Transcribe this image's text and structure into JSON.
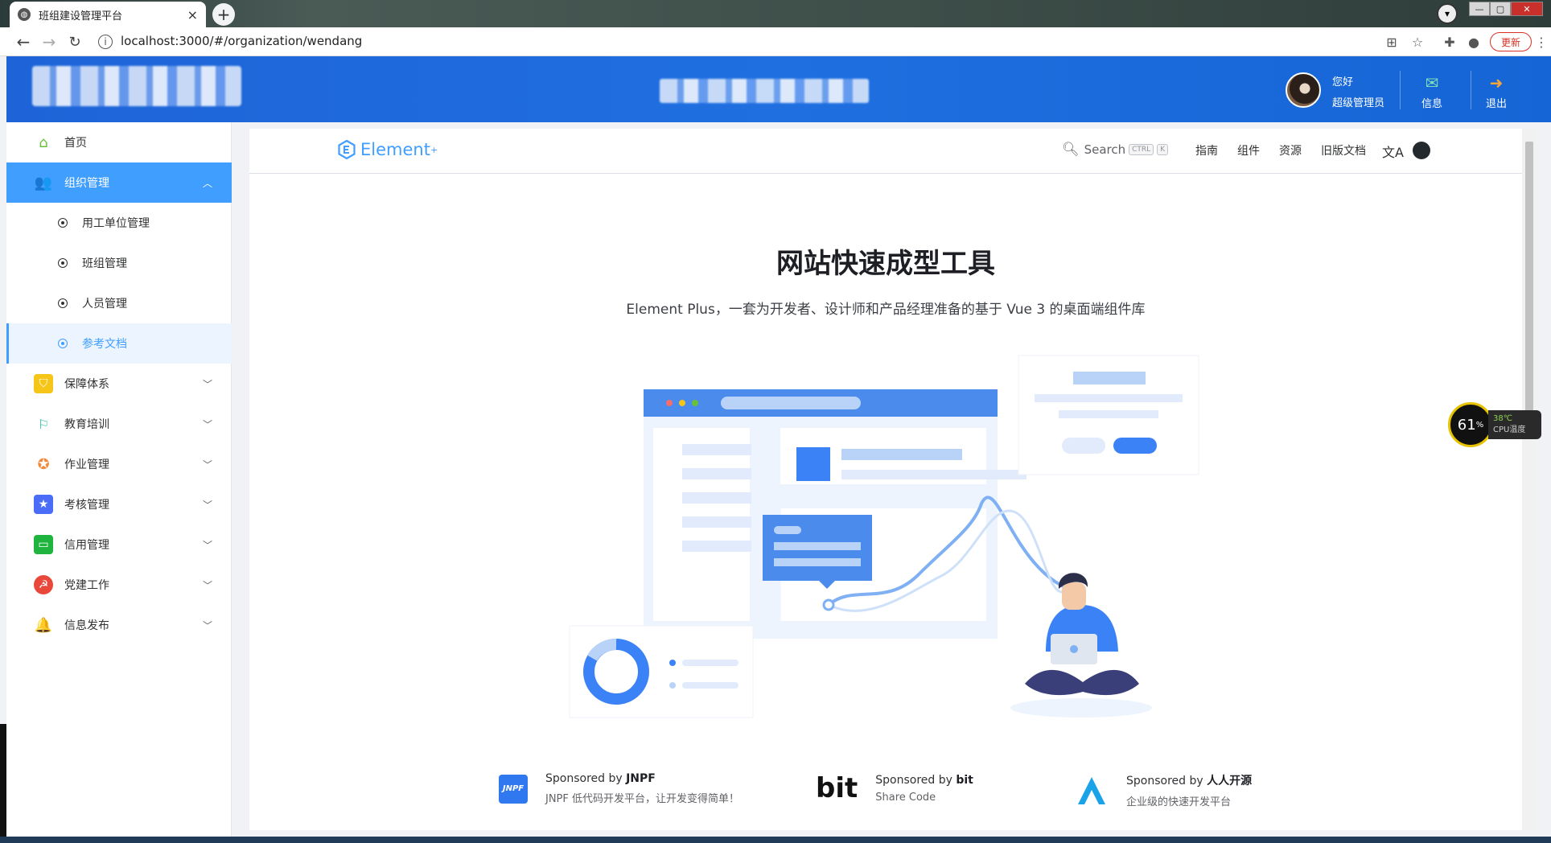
{
  "browser": {
    "tab_title": "班组建设管理平台",
    "tab_close": "×",
    "new_tab": "+",
    "url": "localhost:3000/#/organization/wendang",
    "update_label": "更新",
    "window_buttons": [
      "—",
      "▢",
      "✕"
    ]
  },
  "header": {
    "greeting": "您好",
    "role": "超级管理员",
    "message_label": "信息",
    "logout_label": "退出"
  },
  "sidebar": {
    "items": [
      {
        "label": "首页",
        "icon": "home-icon",
        "color": "#67c23a"
      },
      {
        "label": "组织管理",
        "icon": "users-icon",
        "color": "#409eff",
        "expanded": true
      },
      {
        "label": "保障体系",
        "icon": "shield-icon",
        "color": "#f5c518"
      },
      {
        "label": "教育培训",
        "icon": "training-icon",
        "color": "#1bbc9b"
      },
      {
        "label": "作业管理",
        "icon": "task-icon",
        "color": "#f08a3c"
      },
      {
        "label": "考核管理",
        "icon": "assessment-icon",
        "color": "#4a6cf7"
      },
      {
        "label": "信用管理",
        "icon": "credit-icon",
        "color": "#1fb43e"
      },
      {
        "label": "党建工作",
        "icon": "party-icon",
        "color": "#e8473a"
      },
      {
        "label": "信息发布",
        "icon": "bell-icon",
        "color": "#2aa4f4"
      }
    ],
    "sub_items": [
      {
        "label": "用工单位管理"
      },
      {
        "label": "班组管理"
      },
      {
        "label": "人员管理"
      },
      {
        "label": "参考文档",
        "active": true
      }
    ]
  },
  "docs": {
    "logo_text": "Element",
    "search_label": "Search",
    "search_keys": [
      "CTRL",
      "K"
    ],
    "nav": [
      "指南",
      "组件",
      "资源",
      "旧版文档"
    ],
    "hero_title": "网站快速成型工具",
    "hero_subtitle": "Element Plus，一套为开发者、设计师和产品经理准备的基于 Vue 3 的桌面端组件库",
    "sponsors": [
      {
        "prefix": "Sponsored by ",
        "name": "JNPF",
        "desc": "JNPF 低代码开发平台，让开发变得简单！",
        "logo": "JNPF"
      },
      {
        "prefix": "Sponsored by ",
        "name": "bit",
        "desc": "Share Code",
        "logo": "bit"
      },
      {
        "prefix": "Sponsored by ",
        "name": "人人开源",
        "desc": "企业级的快速开发平台",
        "logo": ""
      }
    ]
  },
  "cpu": {
    "percent": "61",
    "unit": "%",
    "temp": "38℃",
    "label": "CPU温度"
  },
  "colors": {
    "accent": "#409eff",
    "header": "#1f6fe0"
  }
}
